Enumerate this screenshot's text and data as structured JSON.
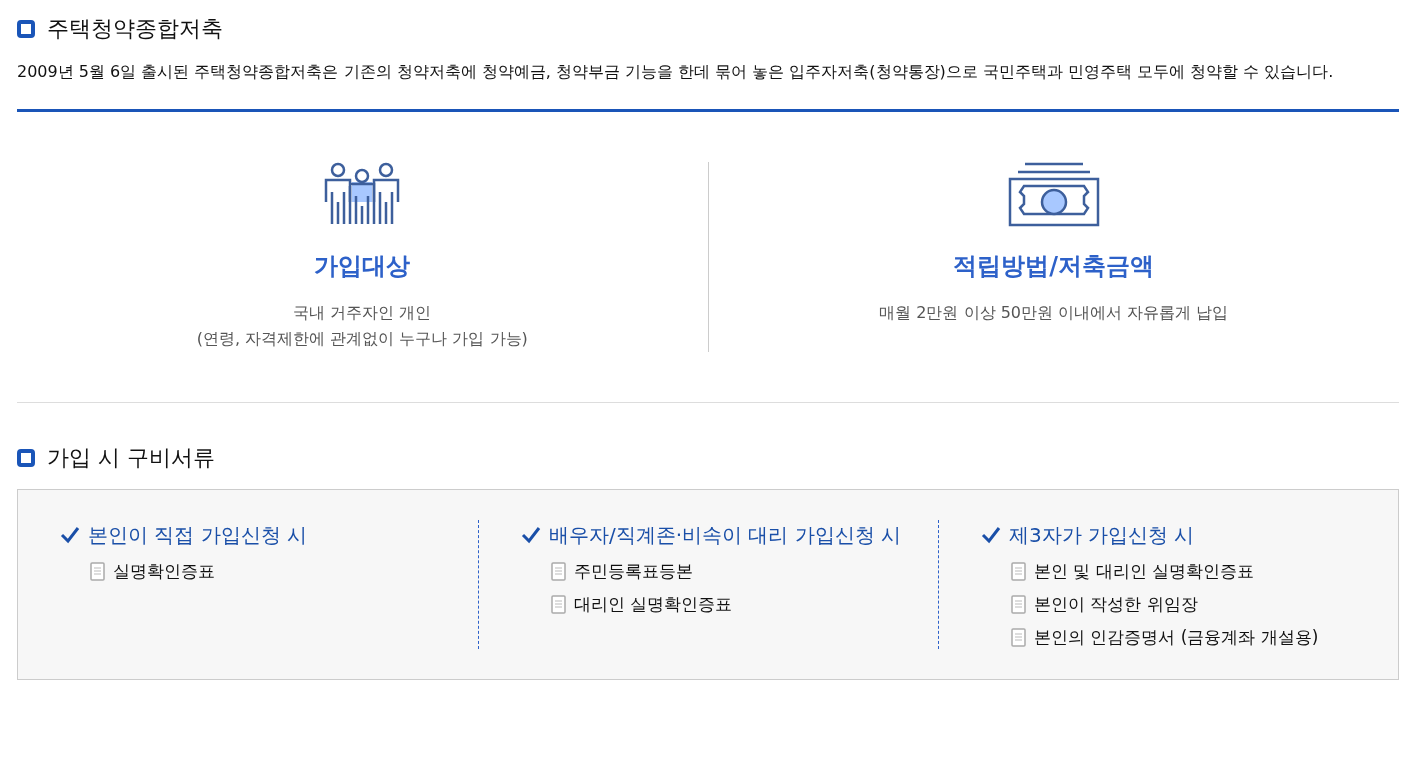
{
  "section_1": {
    "title": "주택청약종합저축",
    "description": "2009년 5월 6일 출시된 주택청약종합저축은 기존의 청약저축에 청약예금, 청약부금 기능을 한데 묶어 놓은 입주자저축(청약통장)으로 국민주택과 민영주택 모두에 청약할 수 있습니다.",
    "features": [
      {
        "kind": "people",
        "title": "가입대상",
        "lines": [
          "국내 거주자인 개인",
          "(연령, 자격제한에 관계없이 누구나 가입 가능)"
        ]
      },
      {
        "kind": "money",
        "title": "적립방법/저축금액",
        "lines": [
          "매월 2만원 이상 50만원 이내에서 자유롭게 납입"
        ]
      }
    ]
  },
  "section_2": {
    "title": "가입 시 구비서류",
    "columns": [
      {
        "title": "본인이 직접 가입신청 시",
        "documents": [
          "실명확인증표"
        ]
      },
      {
        "title": "배우자/직계존·비속이 대리 가입신청 시",
        "documents": [
          "주민등록표등본",
          "대리인 실명확인증표"
        ]
      },
      {
        "title": "제3자가 가입신청 시",
        "documents": [
          "본인 및 대리인 실명확인증표",
          "본인이 작성한 위임장",
          "본인의 인감증명서 (금융계좌 개설용)"
        ]
      }
    ]
  }
}
